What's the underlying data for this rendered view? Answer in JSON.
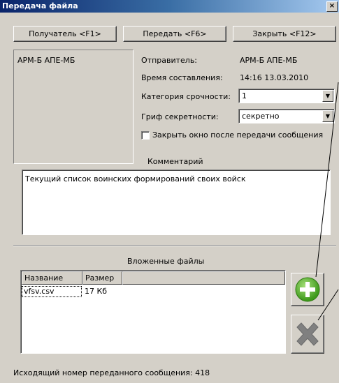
{
  "window": {
    "title": "Передача файла",
    "close_glyph": "×"
  },
  "buttons": {
    "recipient": "Получатель <F1>",
    "send": "Передать <F6>",
    "close": "Закрыть <F12>"
  },
  "recipients": [
    "АРМ-Б АПЕ-МБ"
  ],
  "fields": {
    "sender_label": "Отправитель:",
    "sender_value": "АРМ-Б АПЕ-МБ",
    "time_label": "Время составления:",
    "time_value": "14:16 13.03.2010",
    "urgency_label": "Категория срочности:",
    "urgency_value": "1",
    "secrecy_label": "Гриф секретности:",
    "secrecy_value": "секретно",
    "close_after_label": "Закрыть окно после передачи сообщения"
  },
  "comment": {
    "label": "Комментарий",
    "text": "Текущий список воинских формирований своих войск"
  },
  "attachments": {
    "label": "Вложенные файлы",
    "columns": [
      "Название",
      "Размер"
    ],
    "rows": [
      {
        "name": "vfsv.csv",
        "size": "17 Кб"
      }
    ]
  },
  "footer": {
    "text": "Исходящий номер переданного сообщения: 418"
  },
  "icons": {
    "add": "add-file-icon",
    "remove": "remove-file-icon"
  },
  "colors": {
    "title_start": "#0a246a",
    "add_green": "#5cb82a",
    "remove_gray": "#808080"
  }
}
